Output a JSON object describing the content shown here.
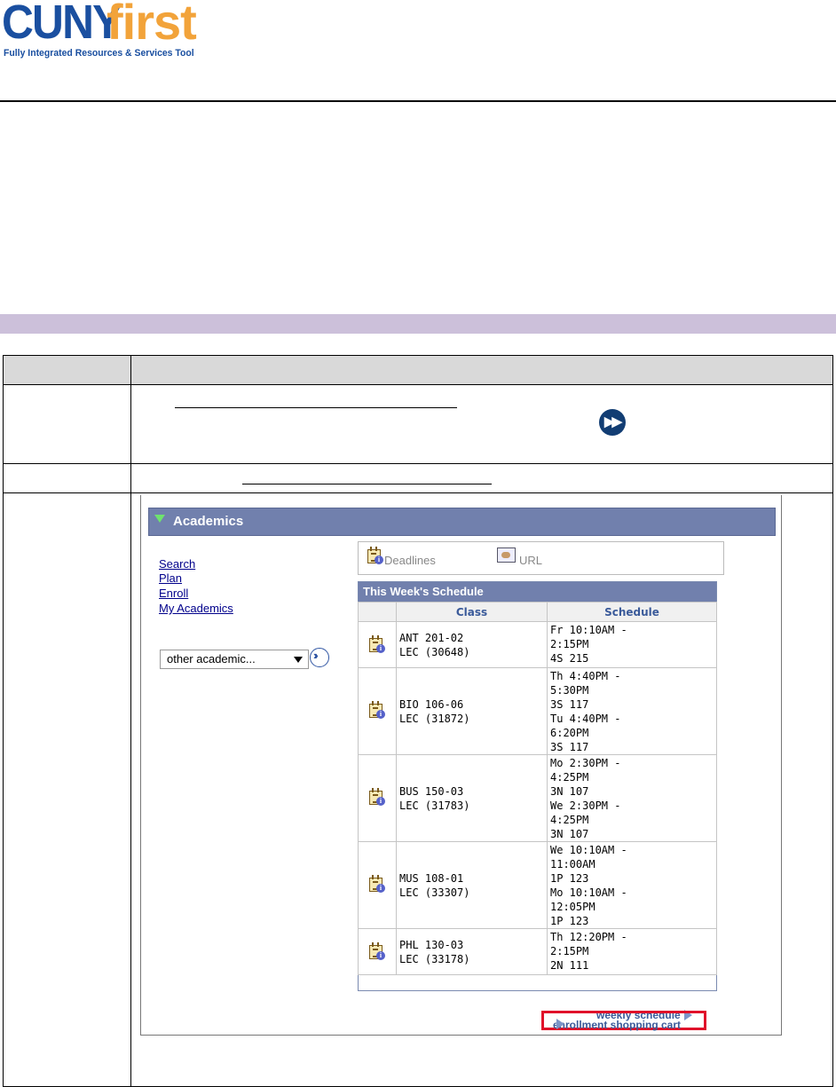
{
  "logo": {
    "brand_a": "CUNY",
    "brand_b": "first",
    "tagline": "Fully Integrated Resources & Services Tool"
  },
  "panel": {
    "title": "Academics",
    "links": [
      "Search",
      "Plan",
      "Enroll",
      "My Academics"
    ],
    "other_select": "other academic...",
    "deadlines": "Deadlines",
    "url": "URL",
    "schedule_title": "This Week's Schedule",
    "headers": {
      "class": "Class",
      "schedule": "Schedule"
    },
    "rows": [
      {
        "class": "ANT 201-02\nLEC (30648)",
        "schedule": "Fr 10:10AM -\n2:15PM\n4S 215"
      },
      {
        "class": "BIO 106-06\nLEC (31872)",
        "schedule": "Th 4:40PM -\n5:30PM\n3S 117\nTu 4:40PM -\n6:20PM\n3S 117"
      },
      {
        "class": "BUS 150-03\nLEC (31783)",
        "schedule": "Mo 2:30PM -\n4:25PM\n3N 107\nWe 2:30PM -\n4:25PM\n3N 107"
      },
      {
        "class": "MUS 108-01\nLEC (33307)",
        "schedule": "We 10:10AM -\n11:00AM\n1P 123\nMo 10:10AM -\n12:05PM\n1P 123"
      },
      {
        "class": "PHL 130-03\nLEC (33178)",
        "schedule": "Th 12:20PM -\n2:15PM\n2N 111"
      }
    ],
    "weekly_link": "weekly schedule",
    "cart_link": "enrollment shopping cart"
  },
  "colors": {
    "band": "#ccc0da",
    "panel_header": "#7180ad",
    "highlight": "#e0102a"
  }
}
